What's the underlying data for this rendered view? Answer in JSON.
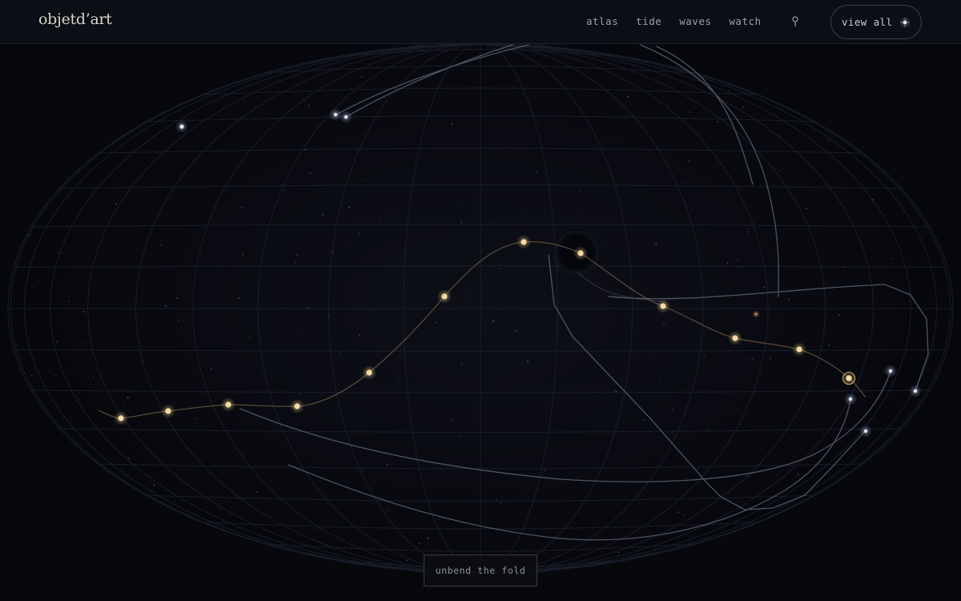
{
  "brand": {
    "logo_text": "objetd’art"
  },
  "nav": {
    "items": [
      {
        "label": "atlas"
      },
      {
        "label": "tide"
      },
      {
        "label": "waves"
      },
      {
        "label": "watch"
      }
    ],
    "pin_icon": "map-pin-icon"
  },
  "view_all": {
    "label": "view all",
    "icon": "sparkle-icon"
  },
  "controls": {
    "unbend_label": "unbend the fold"
  },
  "colors": {
    "background": "#07080d",
    "header_bg": "#0a0e15",
    "constellation_star": "#f3d9a4",
    "constellation_line": "#7d6a48",
    "trail": "#5d6576",
    "grid": "#1a1f2b"
  }
}
